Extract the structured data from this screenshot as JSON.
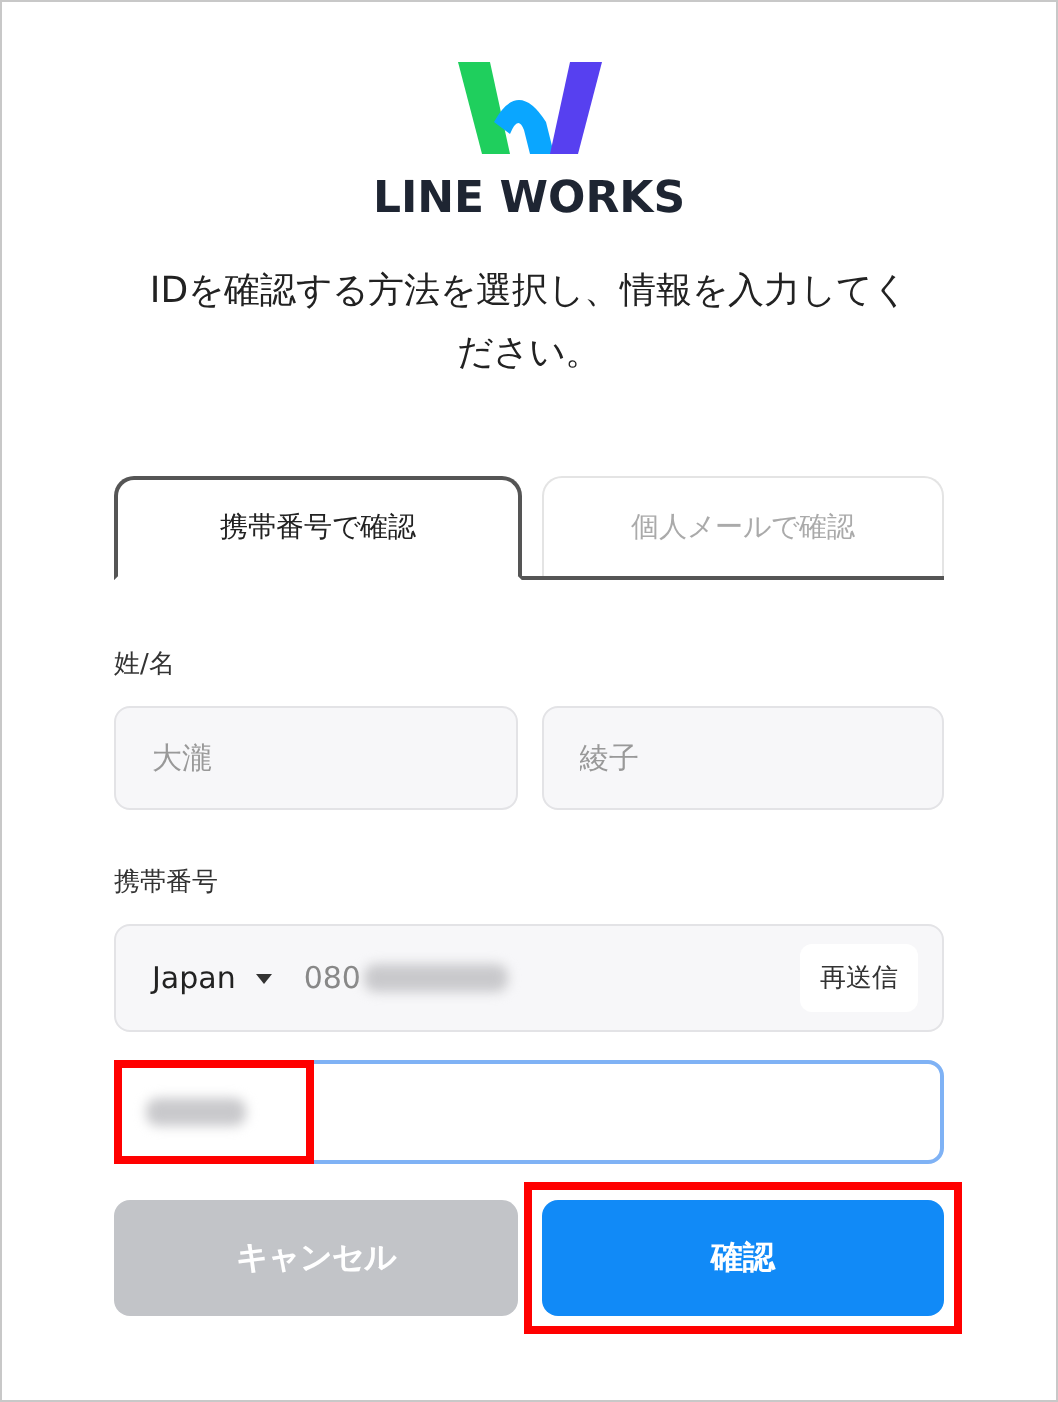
{
  "logo": {
    "wordmark": "LINE WORKS"
  },
  "instruction": "IDを確認する方法を選択し、情報を入力してください。",
  "tabs": [
    {
      "label": "携帯番号で確認",
      "selected": true
    },
    {
      "label": "個人メールで確認",
      "selected": false
    }
  ],
  "name_section": {
    "label": "姓/名",
    "fields": [
      {
        "placeholder": "大瀧"
      },
      {
        "placeholder": "綾子"
      }
    ]
  },
  "phone_section": {
    "label": "携帯番号",
    "country": "Japan",
    "number": "080",
    "resend_button": "再送信"
  },
  "code_field": {
    "focused": true,
    "highlighted": true
  },
  "buttons": [
    {
      "label": "キャンセル",
      "kind": "cancel",
      "highlighted": false
    },
    {
      "label": "確認",
      "kind": "confirm",
      "highlighted": true
    }
  ]
}
